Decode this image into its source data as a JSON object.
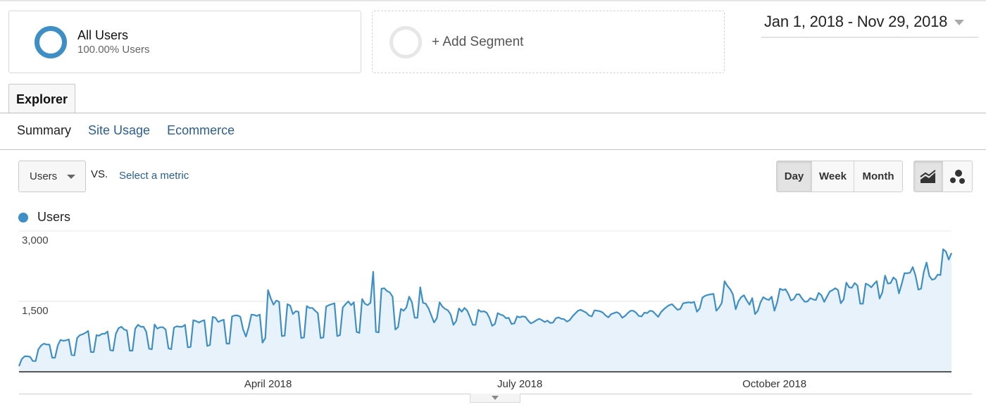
{
  "segments": {
    "primary": {
      "title": "All Users",
      "subtitle": "100.00% Users",
      "color": "#3d8fc6"
    },
    "add_label": "+ Add Segment"
  },
  "date_range": {
    "label": "Jan 1, 2018 - Nov 29, 2018"
  },
  "tabs": [
    {
      "label": "Explorer",
      "active": true
    }
  ],
  "subnav": [
    {
      "label": "Summary",
      "active": true
    },
    {
      "label": "Site Usage",
      "active": false
    },
    {
      "label": "Ecommerce",
      "active": false
    }
  ],
  "controls": {
    "metric_select": "Users",
    "vs_label": "VS.",
    "compare_link": "Select a metric",
    "periods": [
      {
        "label": "Day",
        "active": true
      },
      {
        "label": "Week",
        "active": false
      },
      {
        "label": "Month",
        "active": false
      }
    ],
    "chart_types": [
      {
        "icon": "line-chart-icon",
        "active": true
      },
      {
        "icon": "motion-chart-icon",
        "active": false
      }
    ]
  },
  "chart_data": {
    "type": "area",
    "title": "",
    "legend": [
      {
        "label": "Users",
        "color": "#3d8fc6"
      }
    ],
    "legend_position": "top-left",
    "xlabel": "",
    "ylabel": "",
    "ylim": [
      0,
      3000
    ],
    "yticks": [
      {
        "value": 3000,
        "label": "3,000"
      },
      {
        "value": 1500,
        "label": "1,500"
      }
    ],
    "grid": true,
    "x_start": "2018-01-01",
    "x_end": "2018-11-29",
    "xticks": [
      {
        "day_index": 90,
        "label": "April 2018"
      },
      {
        "day_index": 181,
        "label": "July 2018"
      },
      {
        "day_index": 273,
        "label": "October 2018"
      }
    ],
    "series": [
      {
        "name": "Users",
        "color": "#3d8fc6",
        "values": [
          120,
          270,
          330,
          330,
          320,
          230,
          230,
          480,
          560,
          600,
          580,
          580,
          300,
          300,
          560,
          680,
          660,
          670,
          690,
          360,
          350,
          720,
          780,
          800,
          830,
          870,
          420,
          420,
          780,
          770,
          810,
          810,
          860,
          460,
          450,
          810,
          930,
          960,
          900,
          880,
          450,
          450,
          920,
          1000,
          960,
          960,
          850,
          490,
          480,
          1010,
          920,
          950,
          950,
          900,
          500,
          480,
          940,
          970,
          960,
          960,
          1000,
          520,
          530,
          1100,
          1080,
          1050,
          1080,
          1100,
          550,
          570,
          1170,
          1150,
          1060,
          1090,
          1110,
          600,
          600,
          1180,
          1200,
          1200,
          1170,
          900,
          750,
          950,
          1220,
          1210,
          1190,
          1220,
          620,
          720,
          1740,
          1560,
          1430,
          1520,
          1490,
          760,
          770,
          1440,
          1410,
          1230,
          1290,
          1280,
          720,
          730,
          1400,
          1360,
          1360,
          1300,
          1250,
          720,
          730,
          1390,
          1420,
          1440,
          1460,
          760,
          780,
          1370,
          1440,
          1500,
          1420,
          1480,
          850,
          830,
          1550,
          1450,
          1420,
          1470,
          2130,
          850,
          840,
          1770,
          1780,
          1720,
          1690,
          1600,
          900,
          950,
          1340,
          1300,
          1370,
          1600,
          1480,
          1150,
          1150,
          1800,
          1470,
          1450,
          1350,
          1200,
          1050,
          1140,
          1480,
          1390,
          1340,
          1310,
          1220,
          1000,
          1080,
          1350,
          1280,
          1360,
          1300,
          1160,
          1000,
          1000,
          1320,
          1280,
          1290,
          1260,
          1150,
          980,
          1020,
          1250,
          1220,
          1200,
          1140,
          1150,
          1020,
          1030,
          1180,
          1160,
          1180,
          1170,
          1090,
          1030,
          1060,
          1100,
          1130,
          1100,
          1060,
          1090,
          1040,
          1050,
          1140,
          1160,
          1130,
          1120,
          1070,
          1100,
          1180,
          1240,
          1300,
          1320,
          1290,
          1260,
          1200,
          1180,
          1310,
          1300,
          1290,
          1260,
          1200,
          1160,
          1230,
          1250,
          1270,
          1240,
          1150,
          1190,
          1250,
          1300,
          1300,
          1260,
          1190,
          1180,
          1260,
          1250,
          1300,
          1290,
          1230,
          1170,
          1270,
          1330,
          1380,
          1420,
          1440,
          1380,
          1320,
          1340,
          1460,
          1470,
          1480,
          1470,
          1490,
          1280,
          1350,
          1580,
          1620,
          1640,
          1650,
          1660,
          1300,
          1370,
          1470,
          1930,
          1830,
          1760,
          1650,
          1330,
          1500,
          1590,
          1630,
          1520,
          1430,
          1570,
          1230,
          1300,
          1480,
          1590,
          1550,
          1530,
          1600,
          1300,
          1480,
          1770,
          1740,
          1760,
          1660,
          1520,
          1550,
          1650,
          1650,
          1560,
          1490,
          1500,
          1570,
          1540,
          1530,
          1680,
          1630,
          1490,
          1600,
          1710,
          1740,
          1780,
          1740,
          1460,
          1540,
          1900,
          1800,
          1790,
          1890,
          1840,
          1450,
          1450,
          1880,
          1850,
          1800,
          1870,
          1930,
          1560,
          1690,
          2050,
          1880,
          1890,
          2010,
          1960,
          1670,
          1870,
          2100,
          2100,
          2110,
          2230,
          2050,
          1750,
          1770,
          2130,
          2330,
          2040,
          1960,
          1980,
          2070,
          2060,
          2610,
          2560,
          2390,
          2530
        ]
      }
    ]
  }
}
